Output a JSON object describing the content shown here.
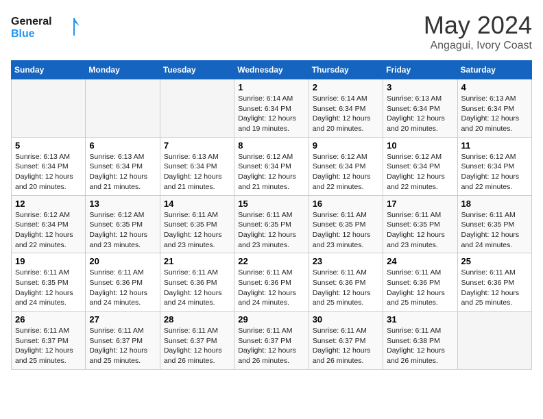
{
  "header": {
    "logo_line1": "General",
    "logo_line2": "Blue",
    "month": "May 2024",
    "location": "Angagui, Ivory Coast"
  },
  "columns": [
    "Sunday",
    "Monday",
    "Tuesday",
    "Wednesday",
    "Thursday",
    "Friday",
    "Saturday"
  ],
  "weeks": [
    [
      {
        "date": "",
        "sunrise": "",
        "sunset": "",
        "daylight": ""
      },
      {
        "date": "",
        "sunrise": "",
        "sunset": "",
        "daylight": ""
      },
      {
        "date": "",
        "sunrise": "",
        "sunset": "",
        "daylight": ""
      },
      {
        "date": "1",
        "sunrise": "Sunrise: 6:14 AM",
        "sunset": "Sunset: 6:34 PM",
        "daylight": "Daylight: 12 hours and 19 minutes."
      },
      {
        "date": "2",
        "sunrise": "Sunrise: 6:14 AM",
        "sunset": "Sunset: 6:34 PM",
        "daylight": "Daylight: 12 hours and 20 minutes."
      },
      {
        "date": "3",
        "sunrise": "Sunrise: 6:13 AM",
        "sunset": "Sunset: 6:34 PM",
        "daylight": "Daylight: 12 hours and 20 minutes."
      },
      {
        "date": "4",
        "sunrise": "Sunrise: 6:13 AM",
        "sunset": "Sunset: 6:34 PM",
        "daylight": "Daylight: 12 hours and 20 minutes."
      }
    ],
    [
      {
        "date": "5",
        "sunrise": "Sunrise: 6:13 AM",
        "sunset": "Sunset: 6:34 PM",
        "daylight": "Daylight: 12 hours and 20 minutes."
      },
      {
        "date": "6",
        "sunrise": "Sunrise: 6:13 AM",
        "sunset": "Sunset: 6:34 PM",
        "daylight": "Daylight: 12 hours and 21 minutes."
      },
      {
        "date": "7",
        "sunrise": "Sunrise: 6:13 AM",
        "sunset": "Sunset: 6:34 PM",
        "daylight": "Daylight: 12 hours and 21 minutes."
      },
      {
        "date": "8",
        "sunrise": "Sunrise: 6:12 AM",
        "sunset": "Sunset: 6:34 PM",
        "daylight": "Daylight: 12 hours and 21 minutes."
      },
      {
        "date": "9",
        "sunrise": "Sunrise: 6:12 AM",
        "sunset": "Sunset: 6:34 PM",
        "daylight": "Daylight: 12 hours and 22 minutes."
      },
      {
        "date": "10",
        "sunrise": "Sunrise: 6:12 AM",
        "sunset": "Sunset: 6:34 PM",
        "daylight": "Daylight: 12 hours and 22 minutes."
      },
      {
        "date": "11",
        "sunrise": "Sunrise: 6:12 AM",
        "sunset": "Sunset: 6:34 PM",
        "daylight": "Daylight: 12 hours and 22 minutes."
      }
    ],
    [
      {
        "date": "12",
        "sunrise": "Sunrise: 6:12 AM",
        "sunset": "Sunset: 6:34 PM",
        "daylight": "Daylight: 12 hours and 22 minutes."
      },
      {
        "date": "13",
        "sunrise": "Sunrise: 6:12 AM",
        "sunset": "Sunset: 6:35 PM",
        "daylight": "Daylight: 12 hours and 23 minutes."
      },
      {
        "date": "14",
        "sunrise": "Sunrise: 6:11 AM",
        "sunset": "Sunset: 6:35 PM",
        "daylight": "Daylight: 12 hours and 23 minutes."
      },
      {
        "date": "15",
        "sunrise": "Sunrise: 6:11 AM",
        "sunset": "Sunset: 6:35 PM",
        "daylight": "Daylight: 12 hours and 23 minutes."
      },
      {
        "date": "16",
        "sunrise": "Sunrise: 6:11 AM",
        "sunset": "Sunset: 6:35 PM",
        "daylight": "Daylight: 12 hours and 23 minutes."
      },
      {
        "date": "17",
        "sunrise": "Sunrise: 6:11 AM",
        "sunset": "Sunset: 6:35 PM",
        "daylight": "Daylight: 12 hours and 23 minutes."
      },
      {
        "date": "18",
        "sunrise": "Sunrise: 6:11 AM",
        "sunset": "Sunset: 6:35 PM",
        "daylight": "Daylight: 12 hours and 24 minutes."
      }
    ],
    [
      {
        "date": "19",
        "sunrise": "Sunrise: 6:11 AM",
        "sunset": "Sunset: 6:35 PM",
        "daylight": "Daylight: 12 hours and 24 minutes."
      },
      {
        "date": "20",
        "sunrise": "Sunrise: 6:11 AM",
        "sunset": "Sunset: 6:36 PM",
        "daylight": "Daylight: 12 hours and 24 minutes."
      },
      {
        "date": "21",
        "sunrise": "Sunrise: 6:11 AM",
        "sunset": "Sunset: 6:36 PM",
        "daylight": "Daylight: 12 hours and 24 minutes."
      },
      {
        "date": "22",
        "sunrise": "Sunrise: 6:11 AM",
        "sunset": "Sunset: 6:36 PM",
        "daylight": "Daylight: 12 hours and 24 minutes."
      },
      {
        "date": "23",
        "sunrise": "Sunrise: 6:11 AM",
        "sunset": "Sunset: 6:36 PM",
        "daylight": "Daylight: 12 hours and 25 minutes."
      },
      {
        "date": "24",
        "sunrise": "Sunrise: 6:11 AM",
        "sunset": "Sunset: 6:36 PM",
        "daylight": "Daylight: 12 hours and 25 minutes."
      },
      {
        "date": "25",
        "sunrise": "Sunrise: 6:11 AM",
        "sunset": "Sunset: 6:36 PM",
        "daylight": "Daylight: 12 hours and 25 minutes."
      }
    ],
    [
      {
        "date": "26",
        "sunrise": "Sunrise: 6:11 AM",
        "sunset": "Sunset: 6:37 PM",
        "daylight": "Daylight: 12 hours and 25 minutes."
      },
      {
        "date": "27",
        "sunrise": "Sunrise: 6:11 AM",
        "sunset": "Sunset: 6:37 PM",
        "daylight": "Daylight: 12 hours and 25 minutes."
      },
      {
        "date": "28",
        "sunrise": "Sunrise: 6:11 AM",
        "sunset": "Sunset: 6:37 PM",
        "daylight": "Daylight: 12 hours and 26 minutes."
      },
      {
        "date": "29",
        "sunrise": "Sunrise: 6:11 AM",
        "sunset": "Sunset: 6:37 PM",
        "daylight": "Daylight: 12 hours and 26 minutes."
      },
      {
        "date": "30",
        "sunrise": "Sunrise: 6:11 AM",
        "sunset": "Sunset: 6:37 PM",
        "daylight": "Daylight: 12 hours and 26 minutes."
      },
      {
        "date": "31",
        "sunrise": "Sunrise: 6:11 AM",
        "sunset": "Sunset: 6:38 PM",
        "daylight": "Daylight: 12 hours and 26 minutes."
      },
      {
        "date": "",
        "sunrise": "",
        "sunset": "",
        "daylight": ""
      }
    ]
  ]
}
